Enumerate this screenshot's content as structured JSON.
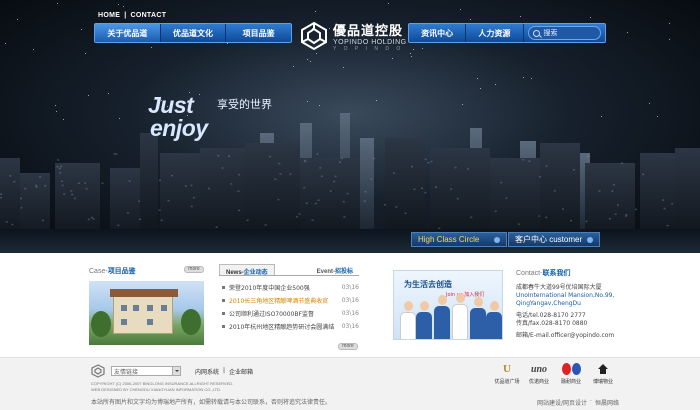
{
  "header": {
    "top_links": [
      "HOME",
      "|",
      "CONTACT"
    ],
    "nav_left": [
      "关于优品道",
      "优品道文化",
      "项目品鉴"
    ],
    "nav_right": [
      "资讯中心",
      "人力资源"
    ],
    "search_label": "搜索",
    "logo": {
      "cn": "優品道控股",
      "en": "YOPINDO HOLDING",
      "sub": "Y O P I N D O"
    }
  },
  "hero": {
    "slogan_line1": "Just",
    "slogan_line2": "enjoy",
    "slogan_cn": "享受的世界",
    "tab_high_class": "High Class Circle",
    "tab_customer": "客户中心 customer"
  },
  "case": {
    "title_lat": "Case-",
    "title_cn": "项目品鉴",
    "more": "more"
  },
  "news": {
    "tab_active_lat": "News-",
    "tab_active_cn": "企业动态",
    "tab_inactive_lat": "Event-",
    "tab_inactive_cn": "招投标",
    "items": [
      {
        "title": "荣登2010年度中国企业500强",
        "date": "03\\16",
        "highlight": false
      },
      {
        "title": "2010长三角地区精酿啤酒节盛典收官",
        "date": "03\\16",
        "highlight": true
      },
      {
        "title": "公司顺利通过ISO70000BF监督",
        "date": "03\\16",
        "highlight": false
      },
      {
        "title": "2010年杭州地区精酿趋势研讨会圆满结",
        "date": "03\\16",
        "highlight": false
      }
    ],
    "more": "more"
  },
  "banner": {
    "headline": "为生活去创造",
    "join": "Join us-加入我们"
  },
  "contact": {
    "title_lat": "Contact-",
    "title_cn": "联系我们",
    "address_cn": "成都春牛大道99号优培国际大厦",
    "address_en": "UnoInternational Mansion,No.99, QingYangav,ChengDu",
    "tel": "电话/tel.028-8170 2777",
    "fax": "传真/fax.028-8170 0880",
    "email": "邮箱/E-mail.officer@yopindo.com"
  },
  "footer": {
    "select_label": "友情链接",
    "links": [
      "内网系统",
      "|",
      "企业邮箱"
    ],
    "copyright_line1": "COPYRIGHT (C) 2006-2007 BINGLONG INSURANCE.ALLRIGHT RESERVED.",
    "copyright_line2": "WEB DESIGNED BY CHENGDU XIANGYUAN INFORMATION CO.,LTD.",
    "notice": "本站所有图片和文字均为博瑞地产所有，如需转载请与本公司联系，否则将追究法律责任。",
    "credits": [
      "网站建设/网页设计",
      "·",
      "恒晨网络"
    ],
    "partners": [
      "优品道广场",
      "优诺商业",
      "融耐商业",
      "博瑞物业"
    ],
    "partner_marks": [
      "U",
      "uno",
      "",
      ""
    ]
  }
}
